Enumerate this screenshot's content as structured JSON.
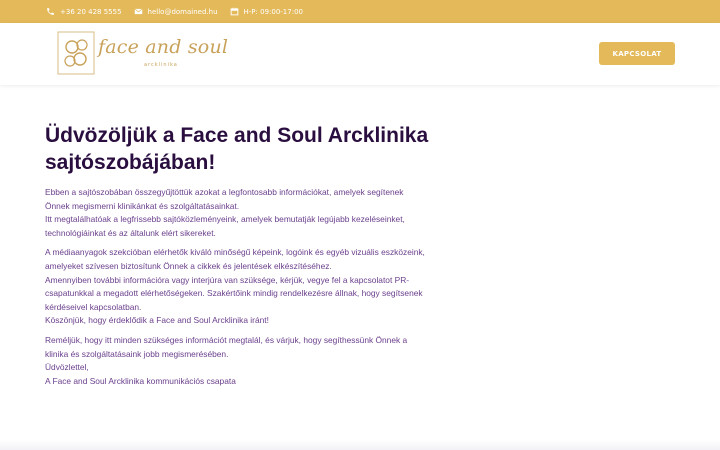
{
  "topbar": {
    "phone": "+36 20 428 5555",
    "email": "hello@domained.hu",
    "hours": "H-P: 09:00-17:00",
    "icons": [
      "phone-icon",
      "envelope-icon",
      "calendar-icon"
    ]
  },
  "header": {
    "logo_text": "face and soul",
    "logo_sub": "arcklinika",
    "contact_label": "KAPCSOLAT"
  },
  "main": {
    "title_line1": "Üdvözöljük a Face and Soul Arcklinika",
    "title_line2": "sajtószobájában!",
    "paragraphs": [
      [
        "Ebben a sajtószobában összegyűjtöttük azokat a legfontosabb információkat, amelyek segítenek",
        "Önnek megismerni klinikánkat és szolgáltatásainkat.",
        "Itt megtalálhatóak a legfrissebb sajtóközleményeink, amelyek bemutatják legújabb kezeléseinket,",
        "technológiáinkat és az általunk elért sikereket."
      ],
      [
        "A médiaanyagok szekcióban elérhetők kiváló minőségű képeink, logóink és egyéb vizuális eszközeink,",
        "amelyeket szívesen biztosítunk Önnek a cikkek és jelentések elkészítéséhez.",
        "Amennyiben további információra vagy interjúra van szüksége, kérjük, vegye fel a kapcsolatot PR-",
        "csapatunkkal a megadott elérhetőségeken. Szakértőink mindig rendelkezésre állnak, hogy segítsenek",
        "kérdéseivel kapcsolatban.",
        "Köszönjük, hogy érdeklődik a Face and Soul Arcklinika iránt!"
      ],
      [
        "Reméljük, hogy itt minden szükséges információt megtalál, és várjuk, hogy segíthessünk Önnek a",
        "klinika és szolgáltatásaink jobb megismerésében.",
        "Üdvözlettel,",
        "A Face and Soul Arcklinika kommunikációs csapata"
      ]
    ]
  },
  "colors": {
    "accent": "#e3b95a",
    "title": "#2a0e3f",
    "body_text": "#6a3f8c",
    "logo": "#c9a25a"
  }
}
